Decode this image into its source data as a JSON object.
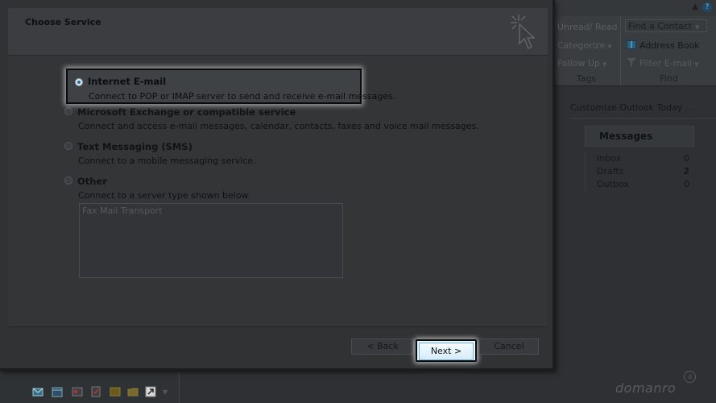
{
  "dialog": {
    "title": "Choose Service",
    "options": [
      {
        "title": "Internet E-mail",
        "description": "Connect to POP or IMAP server to send and receive e-mail messages.",
        "selected": true
      },
      {
        "title": "Microsoft Exchange or compatible service",
        "description": "Connect and access e-mail messages, calendar, contacts, faxes and voice mail messages.",
        "selected": false
      },
      {
        "title": "Text Messaging (SMS)",
        "description": "Connect to a mobile messaging service.",
        "selected": false
      },
      {
        "title": "Other",
        "description": "Connect to a server type shown below.",
        "selected": false
      }
    ],
    "other_list": [
      "Fax Mail Transport"
    ],
    "buttons": {
      "back": "< Back",
      "next": "Next >",
      "cancel": "Cancel"
    }
  },
  "ribbon": {
    "tags": {
      "unread_read": "Unread/ Read",
      "categorize": "Categorize",
      "follow_up": "Follow Up",
      "label": "Tags"
    },
    "find": {
      "find_contact": "Find a Contact",
      "address_book": "Address Book",
      "filter_email": "Filter E-mail",
      "label": "Find"
    }
  },
  "outlook_today": {
    "customize_link": "Customize Outlook Today ...",
    "messages": {
      "title": "Messages",
      "rows": [
        {
          "label": "Inbox",
          "count": "0"
        },
        {
          "label": "Drafts",
          "count": "2"
        },
        {
          "label": "Outbox",
          "count": "0"
        }
      ]
    }
  },
  "watermark": {
    "text": "domanro",
    "badge": "d"
  }
}
